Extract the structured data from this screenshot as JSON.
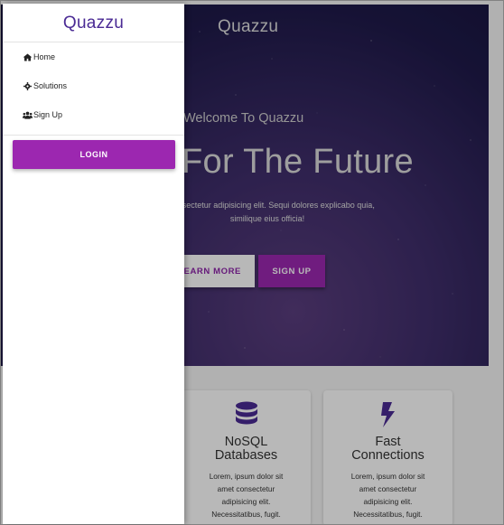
{
  "navbar": {
    "title": "Quazzu"
  },
  "hero": {
    "welcome": "Welcome To Quazzu",
    "headline": "For The Future",
    "lead_line1": "et consectetur adipisicing elit. Sequi dolores explicabo quia,",
    "lead_line2": "similique eius officia!",
    "learn_more": "LEARN MORE",
    "sign_up": "SIGN UP"
  },
  "features": [
    {
      "icon": "database-icon",
      "title_line1": "NoSQL",
      "title_line2": "Databases",
      "text": [
        "Lorem, ipsum dolor sit",
        "amet consectetur",
        "adipisicing elit.",
        "Necessitatibus, fugit."
      ]
    },
    {
      "icon": "bolt-icon",
      "title_line1": "Fast",
      "title_line2": "Connections",
      "text": [
        "Lorem, ipsum dolor sit",
        "amet consectetur",
        "adipisicing elit.",
        "Necessitatibus, fugit."
      ]
    }
  ],
  "drawer": {
    "brand": "Quazzu",
    "items": [
      {
        "label": "Home",
        "icon": "home-icon"
      },
      {
        "label": "Solutions",
        "icon": "gear-icon"
      },
      {
        "label": "Sign Up",
        "icon": "users-icon"
      }
    ],
    "login": "LOGIN"
  },
  "colors": {
    "accent": "#9c27b0",
    "brand": "#4a2a94",
    "feature_icon": "#4a2a94"
  }
}
